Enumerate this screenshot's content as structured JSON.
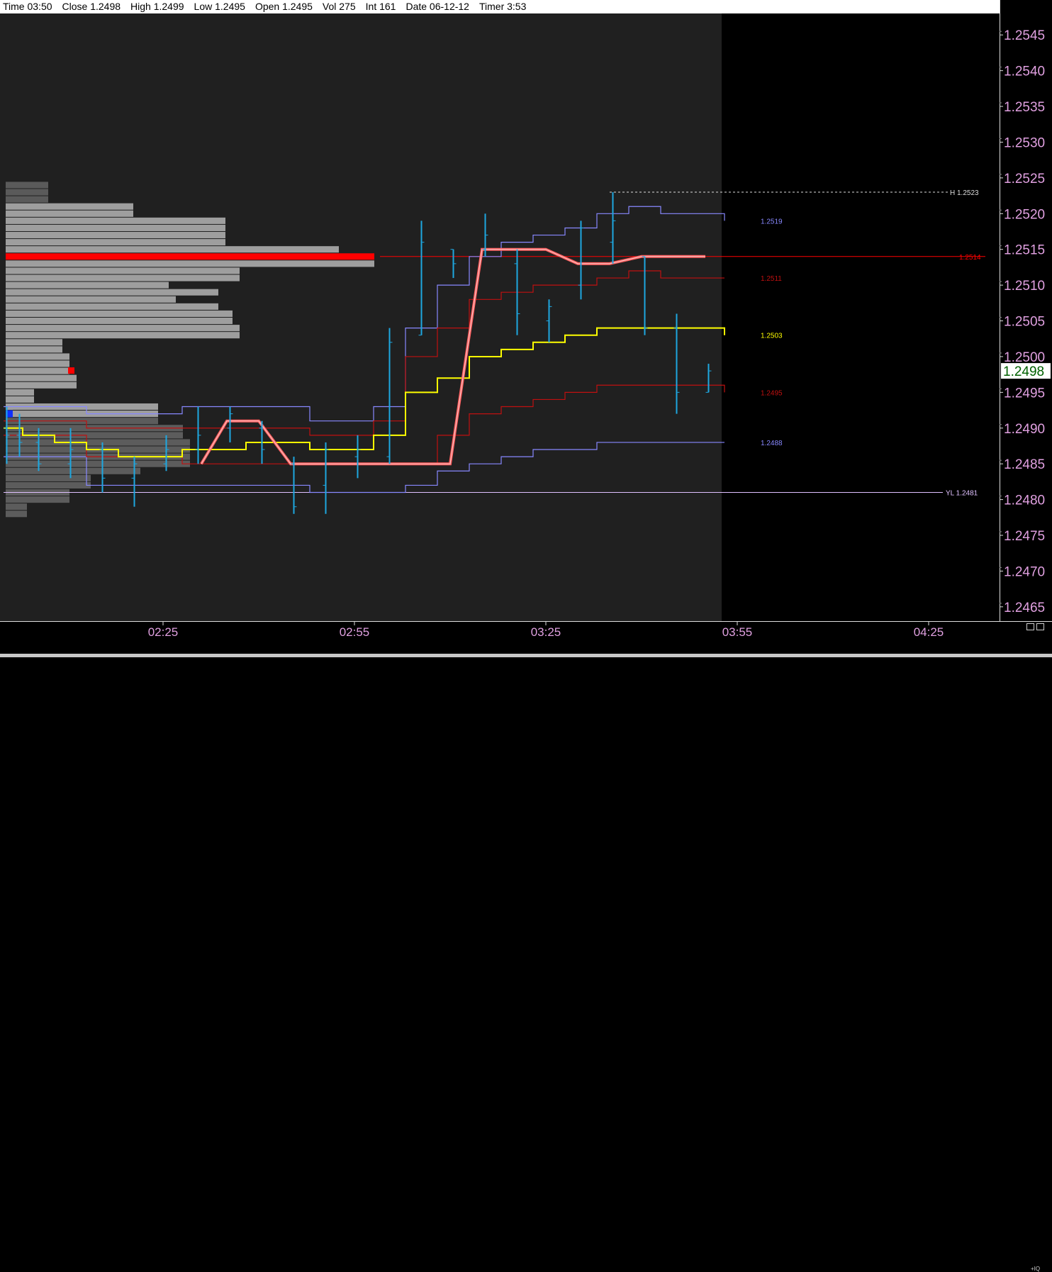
{
  "infobar": {
    "time": "Time 03:50",
    "close": "Close 1.2498",
    "high": "High 1.2499",
    "low": "Low 1.2495",
    "open": "Open 1.2495",
    "vol": "Vol 275",
    "int": "Int 161",
    "date": "Date 06-12-12",
    "timer": "Timer 3:53"
  },
  "corner": {
    "label": "+IQ"
  },
  "colors": {
    "background": "#000000",
    "plot_history": "#202020",
    "bars": "#1ea7e0",
    "vwap": "#ffff00",
    "band1": "#c01010",
    "band2": "#8888ff",
    "poc": "#ff0000",
    "pivot_line": "#ff6060",
    "profile": "#9e9e9e",
    "axis_text": "#e0a0e0"
  },
  "chart_data": {
    "type": "line",
    "ylim": [
      1.2463,
      1.2548
    ],
    "x_ticks": [
      "02:25",
      "02:55",
      "03:25",
      "03:55",
      "04:25"
    ],
    "x_tick_times": [
      25,
      55,
      85,
      115,
      145
    ],
    "time_unit": "minutes after 02:00",
    "y_ticks": [
      "1.2465",
      "1.2470",
      "1.2475",
      "1.2480",
      "1.2485",
      "1.2490",
      "1.2495",
      "1.2500",
      "1.2505",
      "1.2510",
      "1.2515",
      "1.2520",
      "1.2525",
      "1.2530",
      "1.2535",
      "1.2540",
      "1.2545"
    ],
    "last_price": {
      "value": 1.2498,
      "label": "1.2498"
    },
    "price_bars": [
      {
        "t": 0.5,
        "h": 1.2493,
        "l": 1.2485,
        "o": 1.249,
        "c": 1.2489
      },
      {
        "t": 2.5,
        "h": 1.2492,
        "l": 1.2486,
        "o": 1.2489,
        "c": 1.2488
      },
      {
        "t": 5.5,
        "h": 1.249,
        "l": 1.2484,
        "o": 1.2488,
        "c": 1.2485
      },
      {
        "t": 10.5,
        "h": 1.249,
        "l": 1.2483,
        "o": 1.2485,
        "c": 1.2487
      },
      {
        "t": 15.5,
        "h": 1.2488,
        "l": 1.2481,
        "o": 1.2487,
        "c": 1.2483
      },
      {
        "t": 20.5,
        "h": 1.2486,
        "l": 1.2479,
        "o": 1.2483,
        "c": 1.2485
      },
      {
        "t": 25.5,
        "h": 1.2489,
        "l": 1.2484,
        "o": 1.2485,
        "c": 1.2487
      },
      {
        "t": 30.5,
        "h": 1.2493,
        "l": 1.2485,
        "o": 1.2487,
        "c": 1.2489
      },
      {
        "t": 35.5,
        "h": 1.2493,
        "l": 1.2488,
        "o": 1.249,
        "c": 1.2492
      },
      {
        "t": 40.5,
        "h": 1.2491,
        "l": 1.2485,
        "o": 1.249,
        "c": 1.2487
      },
      {
        "t": 45.5,
        "h": 1.2486,
        "l": 1.2478,
        "o": 1.2485,
        "c": 1.2479
      },
      {
        "t": 50.5,
        "h": 1.2488,
        "l": 1.2478,
        "o": 1.2482,
        "c": 1.2487
      },
      {
        "t": 55.5,
        "h": 1.2489,
        "l": 1.2483,
        "o": 1.2486,
        "c": 1.2487
      },
      {
        "t": 60.5,
        "h": 1.2504,
        "l": 1.2485,
        "o": 1.2486,
        "c": 1.2502
      },
      {
        "t": 65.5,
        "h": 1.2519,
        "l": 1.2503,
        "o": 1.2503,
        "c": 1.2516
      },
      {
        "t": 70.5,
        "h": 1.2515,
        "l": 1.2511,
        "o": 1.2515,
        "c": 1.2513
      },
      {
        "t": 75.5,
        "h": 1.252,
        "l": 1.2514,
        "o": 1.2515,
        "c": 1.2517
      },
      {
        "t": 80.5,
        "h": 1.2515,
        "l": 1.2503,
        "o": 1.2513,
        "c": 1.2506
      },
      {
        "t": 85.5,
        "h": 1.2508,
        "l": 1.2502,
        "o": 1.2505,
        "c": 1.2507
      },
      {
        "t": 90.5,
        "h": 1.2519,
        "l": 1.2508,
        "o": 1.251,
        "c": 1.2518
      },
      {
        "t": 95.5,
        "h": 1.2523,
        "l": 1.2513,
        "o": 1.2516,
        "c": 1.2519
      },
      {
        "t": 100.5,
        "h": 1.2514,
        "l": 1.2503,
        "o": 1.2514,
        "c": 1.2504
      },
      {
        "t": 105.5,
        "h": 1.2506,
        "l": 1.2492,
        "o": 1.2504,
        "c": 1.2495
      },
      {
        "t": 110.5,
        "h": 1.2499,
        "l": 1.2495,
        "o": 1.2495,
        "c": 1.2498
      }
    ],
    "vwap": {
      "label": "1.2503",
      "points": [
        [
          0,
          1.249
        ],
        [
          3,
          1.2489
        ],
        [
          8,
          1.2488
        ],
        [
          13,
          1.2487
        ],
        [
          18,
          1.2486
        ],
        [
          28,
          1.2487
        ],
        [
          38,
          1.2488
        ],
        [
          48,
          1.2487
        ],
        [
          58,
          1.2489
        ],
        [
          63,
          1.2495
        ],
        [
          68,
          1.2497
        ],
        [
          73,
          1.25
        ],
        [
          78,
          1.2501
        ],
        [
          83,
          1.2502
        ],
        [
          88,
          1.2503
        ],
        [
          93,
          1.2504
        ],
        [
          98,
          1.2504
        ],
        [
          103,
          1.2504
        ],
        [
          113,
          1.2503
        ]
      ]
    },
    "band_upper1": {
      "label": "1.2511",
      "points": [
        [
          0,
          1.2491
        ],
        [
          13,
          1.249
        ],
        [
          28,
          1.249
        ],
        [
          48,
          1.2489
        ],
        [
          58,
          1.2491
        ],
        [
          63,
          1.25
        ],
        [
          68,
          1.2504
        ],
        [
          73,
          1.2508
        ],
        [
          78,
          1.2509
        ],
        [
          83,
          1.251
        ],
        [
          88,
          1.251
        ],
        [
          93,
          1.2511
        ],
        [
          98,
          1.2512
        ],
        [
          103,
          1.2511
        ],
        [
          113,
          1.2511
        ]
      ]
    },
    "band_lower1": {
      "label": "1.2495",
      "points": [
        [
          0,
          1.2489
        ],
        [
          13,
          1.2486
        ],
        [
          28,
          1.2485
        ],
        [
          48,
          1.2485
        ],
        [
          58,
          1.2485
        ],
        [
          63,
          1.2485
        ],
        [
          68,
          1.2489
        ],
        [
          73,
          1.2492
        ],
        [
          78,
          1.2493
        ],
        [
          83,
          1.2494
        ],
        [
          88,
          1.2495
        ],
        [
          93,
          1.2496
        ],
        [
          98,
          1.2496
        ],
        [
          103,
          1.2496
        ],
        [
          113,
          1.2495
        ]
      ]
    },
    "band_upper2": {
      "label": "1.2519",
      "points": [
        [
          0,
          1.2493
        ],
        [
          13,
          1.2492
        ],
        [
          28,
          1.2493
        ],
        [
          48,
          1.2491
        ],
        [
          58,
          1.2493
        ],
        [
          63,
          1.2504
        ],
        [
          68,
          1.251
        ],
        [
          73,
          1.2514
        ],
        [
          78,
          1.2516
        ],
        [
          83,
          1.2517
        ],
        [
          88,
          1.2518
        ],
        [
          93,
          1.252
        ],
        [
          98,
          1.2521
        ],
        [
          103,
          1.252
        ],
        [
          113,
          1.2519
        ]
      ]
    },
    "band_lower2": {
      "label": "1.2488",
      "points": [
        [
          0,
          1.2486
        ],
        [
          13,
          1.2482
        ],
        [
          28,
          1.2482
        ],
        [
          48,
          1.2481
        ],
        [
          58,
          1.2481
        ],
        [
          63,
          1.2482
        ],
        [
          68,
          1.2484
        ],
        [
          73,
          1.2485
        ],
        [
          78,
          1.2486
        ],
        [
          83,
          1.2487
        ],
        [
          88,
          1.2487
        ],
        [
          93,
          1.2488
        ],
        [
          98,
          1.2488
        ],
        [
          103,
          1.2488
        ],
        [
          113,
          1.2488
        ]
      ]
    },
    "pivot_line": {
      "points": [
        [
          31,
          1.2485
        ],
        [
          35,
          1.2491
        ],
        [
          40,
          1.2491
        ],
        [
          45,
          1.2485
        ],
        [
          70,
          1.2485
        ],
        [
          75,
          1.2515
        ],
        [
          85,
          1.2515
        ],
        [
          90,
          1.2513
        ],
        [
          95,
          1.2513
        ],
        [
          100,
          1.2514
        ],
        [
          110,
          1.2514
        ]
      ]
    },
    "hlines": [
      {
        "name": "high",
        "label": "H 1.2523",
        "value": 1.2523,
        "from_t": 95,
        "style": "dotted"
      },
      {
        "name": "poc",
        "label": "1.2514",
        "value": 1.2514,
        "from_t": 59,
        "style": "solid"
      },
      {
        "name": "yesterday-low",
        "label": "YL 1.2481",
        "value": 1.2481,
        "from_t": 0,
        "style": "solid"
      }
    ],
    "volume_profile": {
      "light_rows": [
        {
          "p": 1.2524,
          "n": 12
        },
        {
          "p": 1.2523,
          "n": 12
        },
        {
          "p": 1.2522,
          "n": 12
        },
        {
          "p": 1.2521,
          "n": 36
        },
        {
          "p": 1.252,
          "n": 36
        },
        {
          "p": 1.2519,
          "n": 62
        },
        {
          "p": 1.2518,
          "n": 62
        },
        {
          "p": 1.2517,
          "n": 62
        },
        {
          "p": 1.2516,
          "n": 62
        },
        {
          "p": 1.2515,
          "n": 94
        },
        {
          "p": 1.2514,
          "n": 104
        },
        {
          "p": 1.2513,
          "n": 104
        },
        {
          "p": 1.2512,
          "n": 66
        },
        {
          "p": 1.2511,
          "n": 66
        },
        {
          "p": 1.251,
          "n": 46
        },
        {
          "p": 1.2509,
          "n": 60
        },
        {
          "p": 1.2508,
          "n": 48
        },
        {
          "p": 1.2507,
          "n": 60
        },
        {
          "p": 1.2506,
          "n": 64
        },
        {
          "p": 1.2505,
          "n": 64
        },
        {
          "p": 1.2504,
          "n": 66
        },
        {
          "p": 1.2503,
          "n": 66
        },
        {
          "p": 1.2502,
          "n": 16
        },
        {
          "p": 1.2501,
          "n": 16
        },
        {
          "p": 1.25,
          "n": 18
        },
        {
          "p": 1.2499,
          "n": 18
        },
        {
          "p": 1.2498,
          "n": 18
        },
        {
          "p": 1.2497,
          "n": 20
        },
        {
          "p": 1.2496,
          "n": 20
        },
        {
          "p": 1.2495,
          "n": 8
        },
        {
          "p": 1.2494,
          "n": 8
        },
        {
          "p": 1.2493,
          "n": 43
        },
        {
          "p": 1.2492,
          "n": 43
        }
      ],
      "dark_rows": [
        {
          "p": 1.2491,
          "n": 43
        },
        {
          "p": 1.249,
          "n": 50
        },
        {
          "p": 1.2489,
          "n": 50
        },
        {
          "p": 1.2488,
          "n": 52
        },
        {
          "p": 1.2487,
          "n": 52
        },
        {
          "p": 1.2486,
          "n": 52
        },
        {
          "p": 1.2485,
          "n": 52
        },
        {
          "p": 1.2484,
          "n": 38
        },
        {
          "p": 1.2483,
          "n": 24
        },
        {
          "p": 1.2482,
          "n": 24
        },
        {
          "p": 1.2481,
          "n": 18
        },
        {
          "p": 1.248,
          "n": 18
        },
        {
          "p": 1.2479,
          "n": 6
        },
        {
          "p": 1.2478,
          "n": 6
        }
      ],
      "poc_price": 1.2514,
      "poc_count": 104
    }
  }
}
